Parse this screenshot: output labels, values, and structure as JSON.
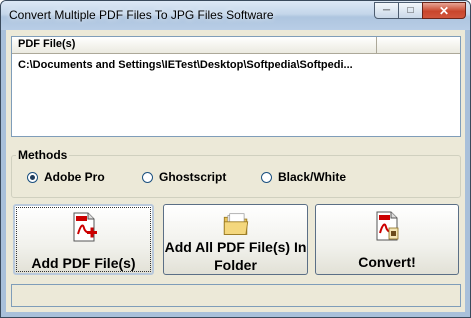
{
  "window": {
    "title": "Convert Multiple PDF Files To JPG Files Software"
  },
  "list": {
    "column_header": "PDF File(s)",
    "rows": [
      "C:\\Documents and Settings\\IETest\\Desktop\\Softpedia\\Softpedi..."
    ]
  },
  "methods": {
    "title": "Methods",
    "options": [
      {
        "label": "Adobe Pro",
        "selected": true
      },
      {
        "label": "Ghostscript",
        "selected": false
      },
      {
        "label": "Black/White",
        "selected": false
      }
    ]
  },
  "buttons": {
    "add_files": "Add PDF File(s)",
    "add_folder": "Add All PDF File(s) In Folder",
    "convert": "Convert!"
  },
  "icons": {
    "add_files": "pdf-add-icon",
    "add_folder": "folder-icon",
    "convert": "pdf-convert-icon"
  }
}
